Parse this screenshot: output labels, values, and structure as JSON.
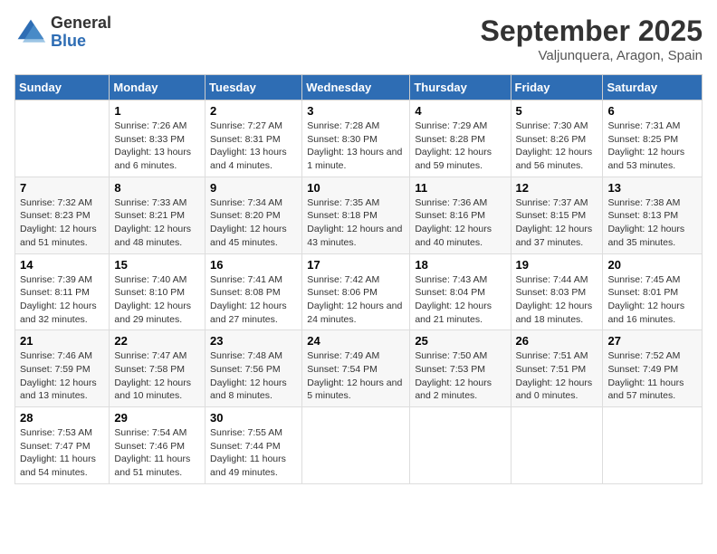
{
  "header": {
    "logo_general": "General",
    "logo_blue": "Blue",
    "month_title": "September 2025",
    "location": "Valjunquera, Aragon, Spain"
  },
  "weekdays": [
    "Sunday",
    "Monday",
    "Tuesday",
    "Wednesday",
    "Thursday",
    "Friday",
    "Saturday"
  ],
  "weeks": [
    [
      {
        "day": "",
        "empty": true
      },
      {
        "day": "1",
        "sunrise": "7:26 AM",
        "sunset": "8:33 PM",
        "daylight": "13 hours and 6 minutes."
      },
      {
        "day": "2",
        "sunrise": "7:27 AM",
        "sunset": "8:31 PM",
        "daylight": "13 hours and 4 minutes."
      },
      {
        "day": "3",
        "sunrise": "7:28 AM",
        "sunset": "8:30 PM",
        "daylight": "13 hours and 1 minute."
      },
      {
        "day": "4",
        "sunrise": "7:29 AM",
        "sunset": "8:28 PM",
        "daylight": "12 hours and 59 minutes."
      },
      {
        "day": "5",
        "sunrise": "7:30 AM",
        "sunset": "8:26 PM",
        "daylight": "12 hours and 56 minutes."
      },
      {
        "day": "6",
        "sunrise": "7:31 AM",
        "sunset": "8:25 PM",
        "daylight": "12 hours and 53 minutes."
      }
    ],
    [
      {
        "day": "7",
        "sunrise": "7:32 AM",
        "sunset": "8:23 PM",
        "daylight": "12 hours and 51 minutes."
      },
      {
        "day": "8",
        "sunrise": "7:33 AM",
        "sunset": "8:21 PM",
        "daylight": "12 hours and 48 minutes."
      },
      {
        "day": "9",
        "sunrise": "7:34 AM",
        "sunset": "8:20 PM",
        "daylight": "12 hours and 45 minutes."
      },
      {
        "day": "10",
        "sunrise": "7:35 AM",
        "sunset": "8:18 PM",
        "daylight": "12 hours and 43 minutes."
      },
      {
        "day": "11",
        "sunrise": "7:36 AM",
        "sunset": "8:16 PM",
        "daylight": "12 hours and 40 minutes."
      },
      {
        "day": "12",
        "sunrise": "7:37 AM",
        "sunset": "8:15 PM",
        "daylight": "12 hours and 37 minutes."
      },
      {
        "day": "13",
        "sunrise": "7:38 AM",
        "sunset": "8:13 PM",
        "daylight": "12 hours and 35 minutes."
      }
    ],
    [
      {
        "day": "14",
        "sunrise": "7:39 AM",
        "sunset": "8:11 PM",
        "daylight": "12 hours and 32 minutes."
      },
      {
        "day": "15",
        "sunrise": "7:40 AM",
        "sunset": "8:10 PM",
        "daylight": "12 hours and 29 minutes."
      },
      {
        "day": "16",
        "sunrise": "7:41 AM",
        "sunset": "8:08 PM",
        "daylight": "12 hours and 27 minutes."
      },
      {
        "day": "17",
        "sunrise": "7:42 AM",
        "sunset": "8:06 PM",
        "daylight": "12 hours and 24 minutes."
      },
      {
        "day": "18",
        "sunrise": "7:43 AM",
        "sunset": "8:04 PM",
        "daylight": "12 hours and 21 minutes."
      },
      {
        "day": "19",
        "sunrise": "7:44 AM",
        "sunset": "8:03 PM",
        "daylight": "12 hours and 18 minutes."
      },
      {
        "day": "20",
        "sunrise": "7:45 AM",
        "sunset": "8:01 PM",
        "daylight": "12 hours and 16 minutes."
      }
    ],
    [
      {
        "day": "21",
        "sunrise": "7:46 AM",
        "sunset": "7:59 PM",
        "daylight": "12 hours and 13 minutes."
      },
      {
        "day": "22",
        "sunrise": "7:47 AM",
        "sunset": "7:58 PM",
        "daylight": "12 hours and 10 minutes."
      },
      {
        "day": "23",
        "sunrise": "7:48 AM",
        "sunset": "7:56 PM",
        "daylight": "12 hours and 8 minutes."
      },
      {
        "day": "24",
        "sunrise": "7:49 AM",
        "sunset": "7:54 PM",
        "daylight": "12 hours and 5 minutes."
      },
      {
        "day": "25",
        "sunrise": "7:50 AM",
        "sunset": "7:53 PM",
        "daylight": "12 hours and 2 minutes."
      },
      {
        "day": "26",
        "sunrise": "7:51 AM",
        "sunset": "7:51 PM",
        "daylight": "12 hours and 0 minutes."
      },
      {
        "day": "27",
        "sunrise": "7:52 AM",
        "sunset": "7:49 PM",
        "daylight": "11 hours and 57 minutes."
      }
    ],
    [
      {
        "day": "28",
        "sunrise": "7:53 AM",
        "sunset": "7:47 PM",
        "daylight": "11 hours and 54 minutes."
      },
      {
        "day": "29",
        "sunrise": "7:54 AM",
        "sunset": "7:46 PM",
        "daylight": "11 hours and 51 minutes."
      },
      {
        "day": "30",
        "sunrise": "7:55 AM",
        "sunset": "7:44 PM",
        "daylight": "11 hours and 49 minutes."
      },
      {
        "day": "",
        "empty": true
      },
      {
        "day": "",
        "empty": true
      },
      {
        "day": "",
        "empty": true
      },
      {
        "day": "",
        "empty": true
      }
    ]
  ],
  "labels": {
    "sunrise": "Sunrise:",
    "sunset": "Sunset:",
    "daylight": "Daylight:"
  }
}
